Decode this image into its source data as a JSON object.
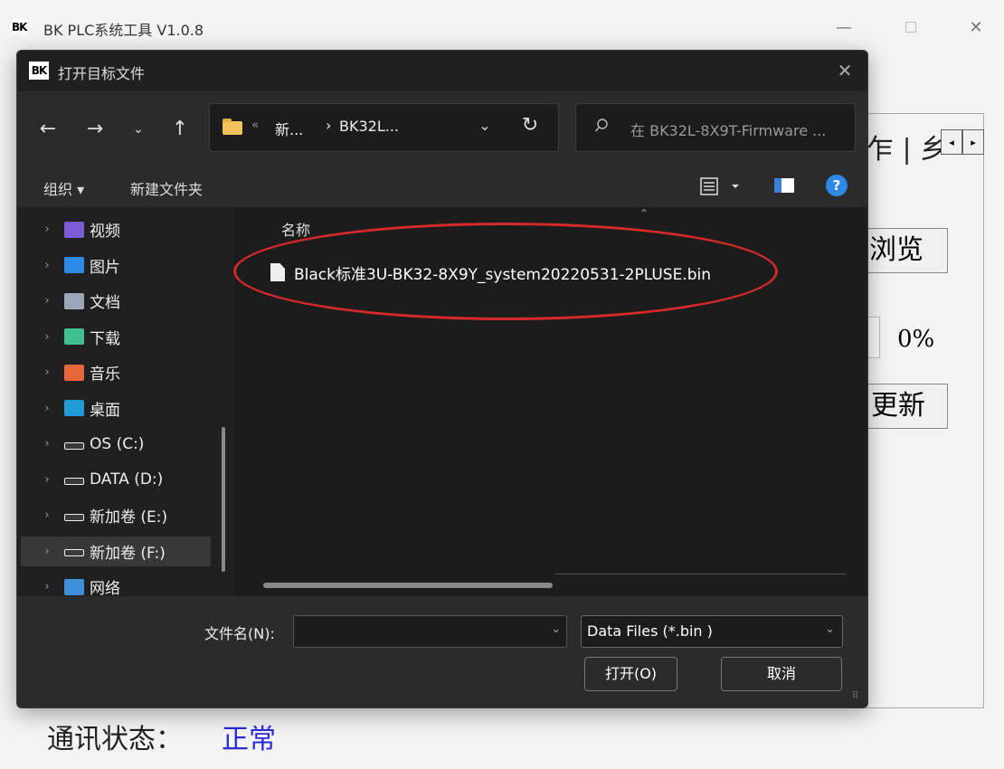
{
  "app": {
    "title": "BK PLC系统工具 V1.0.8",
    "logo_text": "BK",
    "tab_text": "乍 | 乡",
    "browse_label": "浏览",
    "progress_percent": "0%",
    "update_label": "更新",
    "status_label": "通讯状态：",
    "status_value": "正常"
  },
  "dialog": {
    "title": "打开目标文件",
    "logo_text": "BK",
    "address": {
      "more": "«",
      "crumbs": [
        "新...",
        "BK32L..."
      ],
      "separator": "›"
    },
    "search_placeholder": "在 BK32L-8X9T-Firmware ...",
    "toolbar": {
      "organize": "组织 ▾",
      "new_folder": "新建文件夹"
    },
    "nav_items": [
      {
        "label": "视频",
        "icon": "video-icon",
        "color": "#7b5cd6"
      },
      {
        "label": "图片",
        "icon": "pictures-icon",
        "color": "#2d8ae6"
      },
      {
        "label": "文档",
        "icon": "documents-icon",
        "color": "#9aa7b8"
      },
      {
        "label": "下载",
        "icon": "download-icon",
        "color": "#3fbf8f"
      },
      {
        "label": "音乐",
        "icon": "music-icon",
        "color": "#e5673a"
      },
      {
        "label": "桌面",
        "icon": "desktop-icon",
        "color": "#1f9bd6"
      },
      {
        "label": "OS (C:)",
        "icon": "drive-icon",
        "color": "#cfcfcf"
      },
      {
        "label": "DATA (D:)",
        "icon": "drive-icon",
        "color": "#cfcfcf"
      },
      {
        "label": "新加卷 (E:)",
        "icon": "drive-icon",
        "color": "#cfcfcf"
      },
      {
        "label": "新加卷 (F:)",
        "icon": "drive-icon",
        "color": "#cfcfcf"
      },
      {
        "label": "网络",
        "icon": "network-icon",
        "color": "#3c8fd8"
      }
    ],
    "column_header": "名称",
    "files": [
      {
        "name": "Black标准3U-BK32-8X9Y_system20220531-2PLUSE.bin"
      }
    ],
    "filename_label": "文件名(N):",
    "filename_value": "",
    "filetype": "Data Files (*.bin )",
    "open_label": "打开(O)",
    "cancel_label": "取消"
  },
  "colors": {
    "highlight": "#d62a2a",
    "status_ok": "#2a2adb"
  }
}
